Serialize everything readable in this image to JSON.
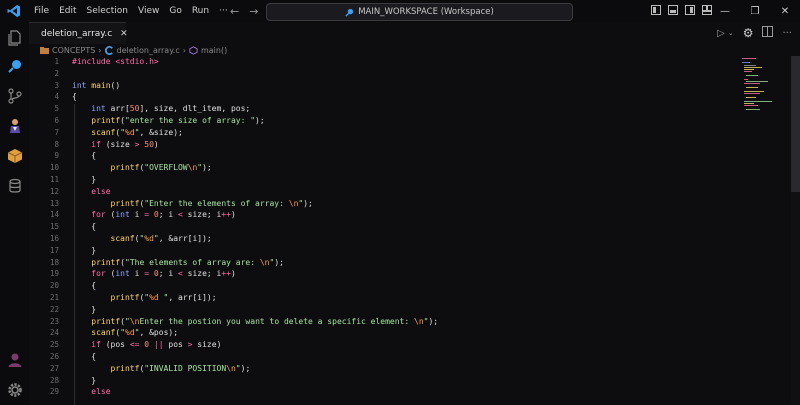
{
  "menu": [
    "File",
    "Edit",
    "Selection",
    "View",
    "Go",
    "Run",
    "···"
  ],
  "search": {
    "label": "MAIN_WORKSPACE (Workspace)"
  },
  "tab": {
    "name": "deletion_array.c",
    "close": "✕"
  },
  "breadcrumb": {
    "folder": "CONCEPTS",
    "file": "deletion_array.c",
    "symbol": "main()",
    "sep": "›"
  },
  "lines": [
    [
      [
        "pr",
        "#include <stdio.h>"
      ]
    ],
    [],
    [
      [
        "t",
        "int "
      ],
      [
        "f",
        "main"
      ],
      [
        "",
        "()"
      ]
    ],
    [
      [
        "",
        "{"
      ]
    ],
    [
      [
        "",
        "    "
      ],
      [
        "t",
        "int "
      ],
      [
        "",
        "arr["
      ],
      [
        "n",
        "50"
      ],
      [
        "",
        "], size, dlt_item, pos;"
      ]
    ],
    [
      [
        "",
        "    "
      ],
      [
        "f",
        "printf"
      ],
      [
        "",
        "("
      ],
      [
        "s",
        "\"enter the size of array: \""
      ],
      [
        "",
        ");"
      ]
    ],
    [
      [
        "",
        "    "
      ],
      [
        "f",
        "scanf"
      ],
      [
        "",
        "("
      ],
      [
        "s",
        "\""
      ],
      [
        "p",
        "%d"
      ],
      [
        "s",
        "\""
      ],
      [
        "",
        ", &size);"
      ]
    ],
    [
      [
        "",
        "    "
      ],
      [
        "k",
        "if "
      ],
      [
        "",
        "(size "
      ],
      [
        "k",
        ">"
      ],
      [
        "n",
        " 50"
      ],
      [
        "",
        ")"
      ]
    ],
    [
      [
        "",
        "    {"
      ]
    ],
    [
      [
        "",
        "        "
      ],
      [
        "f",
        "printf"
      ],
      [
        "",
        "("
      ],
      [
        "s",
        "\"OVERFLOW"
      ],
      [
        "p",
        "\\n"
      ],
      [
        "s",
        "\""
      ],
      [
        "",
        ");"
      ]
    ],
    [
      [
        "",
        "    }"
      ]
    ],
    [
      [
        "",
        "    "
      ],
      [
        "k",
        "else"
      ]
    ],
    [
      [
        "",
        "        "
      ],
      [
        "f",
        "printf"
      ],
      [
        "",
        "("
      ],
      [
        "s",
        "\"Enter the elements of array: "
      ],
      [
        "p",
        "\\n"
      ],
      [
        "s",
        "\""
      ],
      [
        "",
        ");"
      ]
    ],
    [
      [
        "",
        "    "
      ],
      [
        "k",
        "for "
      ],
      [
        "",
        "("
      ],
      [
        "t",
        "int "
      ],
      [
        "",
        "i "
      ],
      [
        "k",
        "="
      ],
      [
        "n",
        " 0"
      ],
      [
        "",
        "; i "
      ],
      [
        "k",
        "<"
      ],
      [
        "",
        " size; i"
      ],
      [
        "k",
        "++"
      ],
      [
        "",
        ")"
      ]
    ],
    [
      [
        "",
        "    {"
      ]
    ],
    [
      [
        "",
        "        "
      ],
      [
        "f",
        "scanf"
      ],
      [
        "",
        "("
      ],
      [
        "s",
        "\""
      ],
      [
        "p",
        "%d"
      ],
      [
        "s",
        "\""
      ],
      [
        "",
        ", &arr[i]);"
      ]
    ],
    [
      [
        "",
        "    }"
      ]
    ],
    [
      [
        "",
        "    "
      ],
      [
        "f",
        "printf"
      ],
      [
        "",
        "("
      ],
      [
        "s",
        "\"The elements of array are: "
      ],
      [
        "p",
        "\\n"
      ],
      [
        "s",
        "\""
      ],
      [
        "",
        ");"
      ]
    ],
    [
      [
        "",
        "    "
      ],
      [
        "k",
        "for "
      ],
      [
        "",
        "("
      ],
      [
        "t",
        "int "
      ],
      [
        "",
        "i "
      ],
      [
        "k",
        "="
      ],
      [
        "n",
        " 0"
      ],
      [
        "",
        "; i "
      ],
      [
        "k",
        "<"
      ],
      [
        "",
        " size; i"
      ],
      [
        "k",
        "++"
      ],
      [
        "",
        ")"
      ]
    ],
    [
      [
        "",
        "    {"
      ]
    ],
    [
      [
        "",
        "        "
      ],
      [
        "f",
        "printf"
      ],
      [
        "",
        "("
      ],
      [
        "s",
        "\""
      ],
      [
        "p",
        "%d"
      ],
      [
        "s",
        " \""
      ],
      [
        "",
        ", arr[i]);"
      ]
    ],
    [
      [
        "",
        "    }"
      ]
    ],
    [
      [
        "",
        "    "
      ],
      [
        "f",
        "printf"
      ],
      [
        "",
        "("
      ],
      [
        "s",
        "\""
      ],
      [
        "p",
        "\\n"
      ],
      [
        "s",
        "Enter the postion you want to delete a specific element: "
      ],
      [
        "p",
        "\\n"
      ],
      [
        "s",
        "\""
      ],
      [
        "",
        ");"
      ]
    ],
    [
      [
        "",
        "    "
      ],
      [
        "f",
        "scanf"
      ],
      [
        "",
        "("
      ],
      [
        "s",
        "\""
      ],
      [
        "p",
        "%d"
      ],
      [
        "s",
        "\""
      ],
      [
        "",
        ", &pos);"
      ]
    ],
    [
      [
        "",
        "    "
      ],
      [
        "k",
        "if "
      ],
      [
        "",
        "(pos "
      ],
      [
        "k",
        "<="
      ],
      [
        "n",
        " 0"
      ],
      [
        "",
        " "
      ],
      [
        "k",
        "||"
      ],
      [
        "",
        " pos "
      ],
      [
        "k",
        ">"
      ],
      [
        "",
        " size)"
      ]
    ],
    [
      [
        "",
        "    {"
      ]
    ],
    [
      [
        "",
        "        "
      ],
      [
        "f",
        "printf"
      ],
      [
        "",
        "("
      ],
      [
        "s",
        "\"INVALID POSITION"
      ],
      [
        "p",
        "\\n"
      ],
      [
        "s",
        "\""
      ],
      [
        "",
        ");"
      ]
    ],
    [
      [
        "",
        "    }"
      ]
    ],
    [
      [
        "",
        "    "
      ],
      [
        "k",
        "else"
      ]
    ]
  ],
  "colors": {
    "keyword": "#ff6fa8",
    "type": "#8aa8ff",
    "function": "#ffd56b",
    "string": "#a6e3a1",
    "format": "#ff9f43",
    "number": "#f78c6c"
  }
}
